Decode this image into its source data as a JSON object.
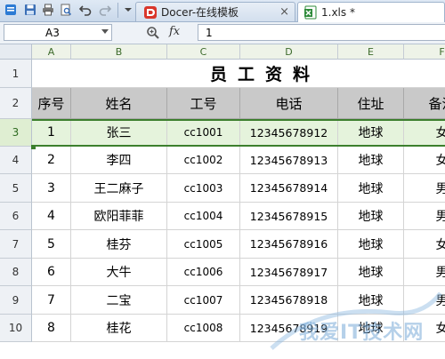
{
  "tabs": [
    {
      "label": "Docer-在线模板",
      "close": "×",
      "active": false
    },
    {
      "label": "1.xls *",
      "close": "×",
      "active": true
    }
  ],
  "formula_bar": {
    "name_box": "A3",
    "fx": "fx",
    "value": "1"
  },
  "grid": {
    "columns": [
      "A",
      "B",
      "C",
      "D",
      "E",
      "F"
    ],
    "row_numbers": [
      "1",
      "2",
      "3",
      "4",
      "5",
      "6",
      "7",
      "8",
      "9",
      "10"
    ],
    "title": "员工资料",
    "headers": [
      "序号",
      "姓名",
      "工号",
      "电话",
      "住址",
      "备注"
    ],
    "rows": [
      [
        "1",
        "张三",
        "cc1001",
        "12345678912",
        "地球",
        "女"
      ],
      [
        "2",
        "李四",
        "cc1002",
        "12345678913",
        "地球",
        "女"
      ],
      [
        "3",
        "王二麻子",
        "cc1003",
        "12345678914",
        "地球",
        "男"
      ],
      [
        "4",
        "欧阳菲菲",
        "cc1004",
        "12345678915",
        "地球",
        "男"
      ],
      [
        "5",
        "桂芬",
        "cc1005",
        "12345678916",
        "地球",
        "女"
      ],
      [
        "6",
        "大牛",
        "cc1006",
        "12345678917",
        "地球",
        "男"
      ],
      [
        "7",
        "二宝",
        "cc1007",
        "12345678918",
        "地球",
        "男"
      ],
      [
        "8",
        "桂花",
        "cc1008",
        "12345678919",
        "地球",
        "女"
      ]
    ]
  },
  "watermark": {
    "text": "我爱IT技术网"
  },
  "colors": {
    "selection": "#3c7f2d",
    "header_fill": "#c9c9c9",
    "active_row": "#e5f3dc"
  }
}
